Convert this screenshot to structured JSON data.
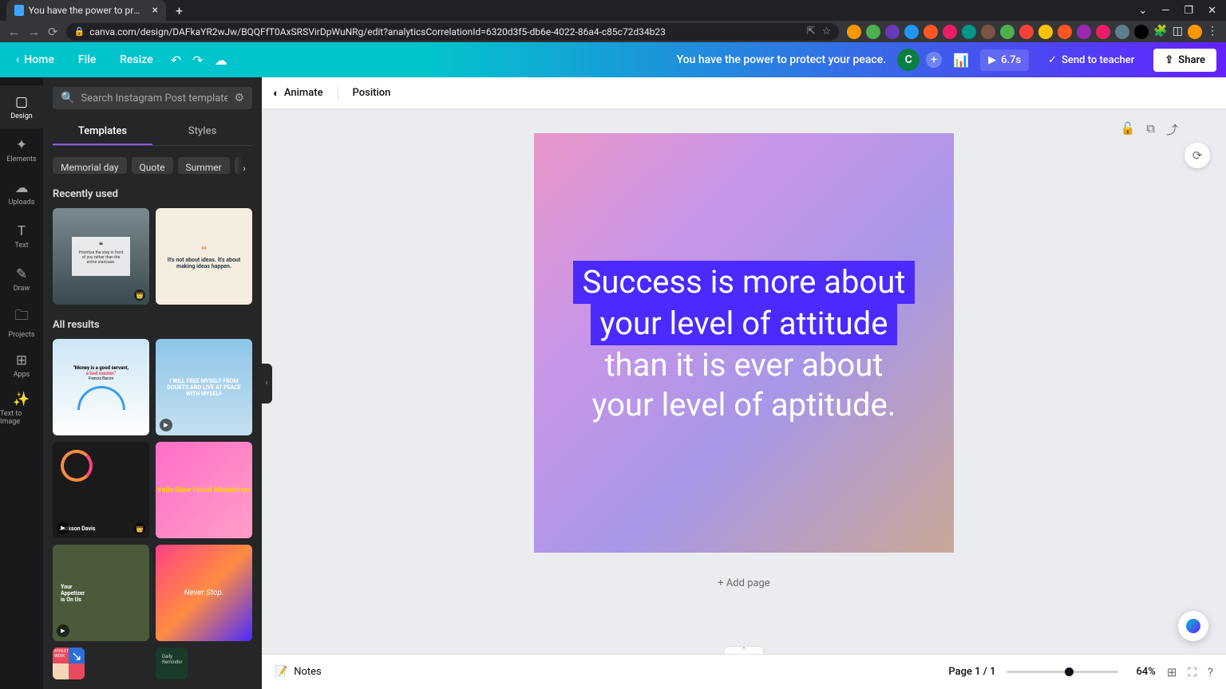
{
  "browser": {
    "tab_title": "You have the power to protect y…",
    "url": "canva.com/design/DAFkaYR2wJw/BQQFfT0AxSRSVirDpWuNRg/edit?analyticsCorrelationId=6320d3f5-db6e-4022-86a4-c85c72d34b23"
  },
  "header": {
    "home": "Home",
    "file": "File",
    "resize": "Resize",
    "doc_title": "You have the power to protect your peace.",
    "avatar_letter": "C",
    "duration": "6.7s",
    "send_label": "Send to teacher",
    "share": "Share"
  },
  "toolrail": {
    "items": [
      {
        "label": "Design",
        "icon": "▢"
      },
      {
        "label": "Elements",
        "icon": "✦"
      },
      {
        "label": "Uploads",
        "icon": "☁"
      },
      {
        "label": "Text",
        "icon": "T"
      },
      {
        "label": "Draw",
        "icon": "✎"
      },
      {
        "label": "Projects",
        "icon": "🗀"
      },
      {
        "label": "Apps",
        "icon": "⊞"
      },
      {
        "label": "Text to Image",
        "icon": "✨"
      }
    ]
  },
  "panel": {
    "search_placeholder": "Search Instagram Post templates",
    "tabs": {
      "templates": "Templates",
      "styles": "Styles"
    },
    "chips": [
      "Memorial day",
      "Quote",
      "Summer",
      "Coll"
    ],
    "recently_used": "Recently used",
    "all_results": "All results",
    "templates": {
      "r1": {
        "quote": "Prioritize the step in front of you rather than the entire staircase."
      },
      "r2": {
        "quote": "It's not about ideas. It's about making ideas happen."
      },
      "a1": {
        "line1": "\"Money is a good servant,",
        "line2": "a bad master.\"",
        "author": "Francis Bacon"
      },
      "a2": {
        "text": "I WILL FREE MYSELF FROM DOUBTS AND LIVE AT PEACE WITH MYSELF"
      },
      "a3": {
        "name": "Jackson Davis"
      },
      "a4": {
        "text": "Valla Glow Facial Moisturizer"
      },
      "a5": {
        "line1": "Your",
        "line2": "Appetizer",
        "line3": "is On Us"
      },
      "a6": {
        "text": "Never Stop."
      },
      "a7": {
        "text": "ATHLETICS WEEK"
      },
      "a8": {
        "text": "Daily Reminder"
      }
    }
  },
  "toolbar": {
    "animate": "Animate",
    "position": "Position"
  },
  "canvas": {
    "quote_line1": "Success is more about",
    "quote_line2": "your level of attitude",
    "quote_line3": "than it is ever about",
    "quote_line4": "your level of aptitude.",
    "add_page": "+ Add page"
  },
  "footer": {
    "notes": "Notes",
    "page_indicator": "Page 1 / 1",
    "zoom": "64%"
  }
}
